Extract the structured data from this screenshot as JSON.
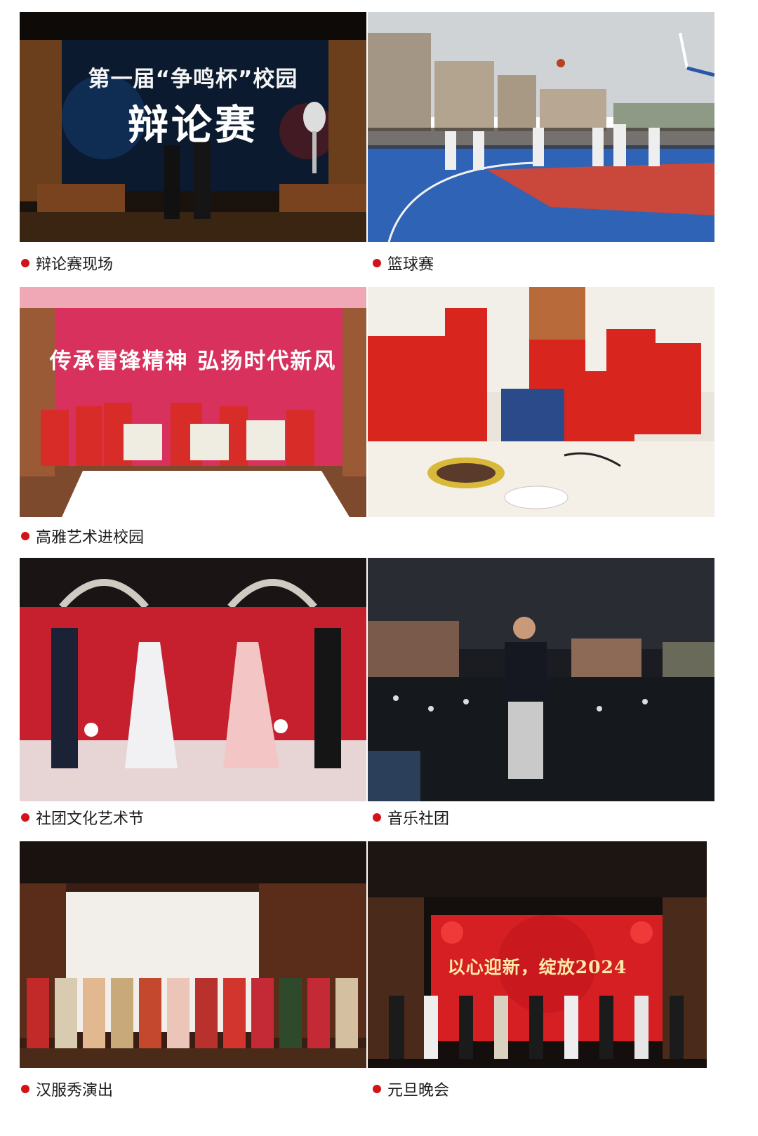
{
  "colors": {
    "accent_red": "#d21418",
    "caption_text": "#1a1a1a"
  },
  "photos": [
    {
      "caption": "辩论赛现场",
      "overlay_line1": "第一届“争鸣杯”校园",
      "overlay_line2": "辩论赛"
    },
    {
      "caption": "篮球赛"
    },
    {
      "caption": "高雅艺术进校园",
      "banner": "传承雷锋精神  弘扬时代新风"
    },
    {
      "caption": ""
    },
    {
      "caption": "社团文化艺术节"
    },
    {
      "caption": "音乐社团"
    },
    {
      "caption": "汉服秀演出"
    },
    {
      "caption": "元旦晚会",
      "banner": "以心迎新，绽放2024"
    }
  ]
}
